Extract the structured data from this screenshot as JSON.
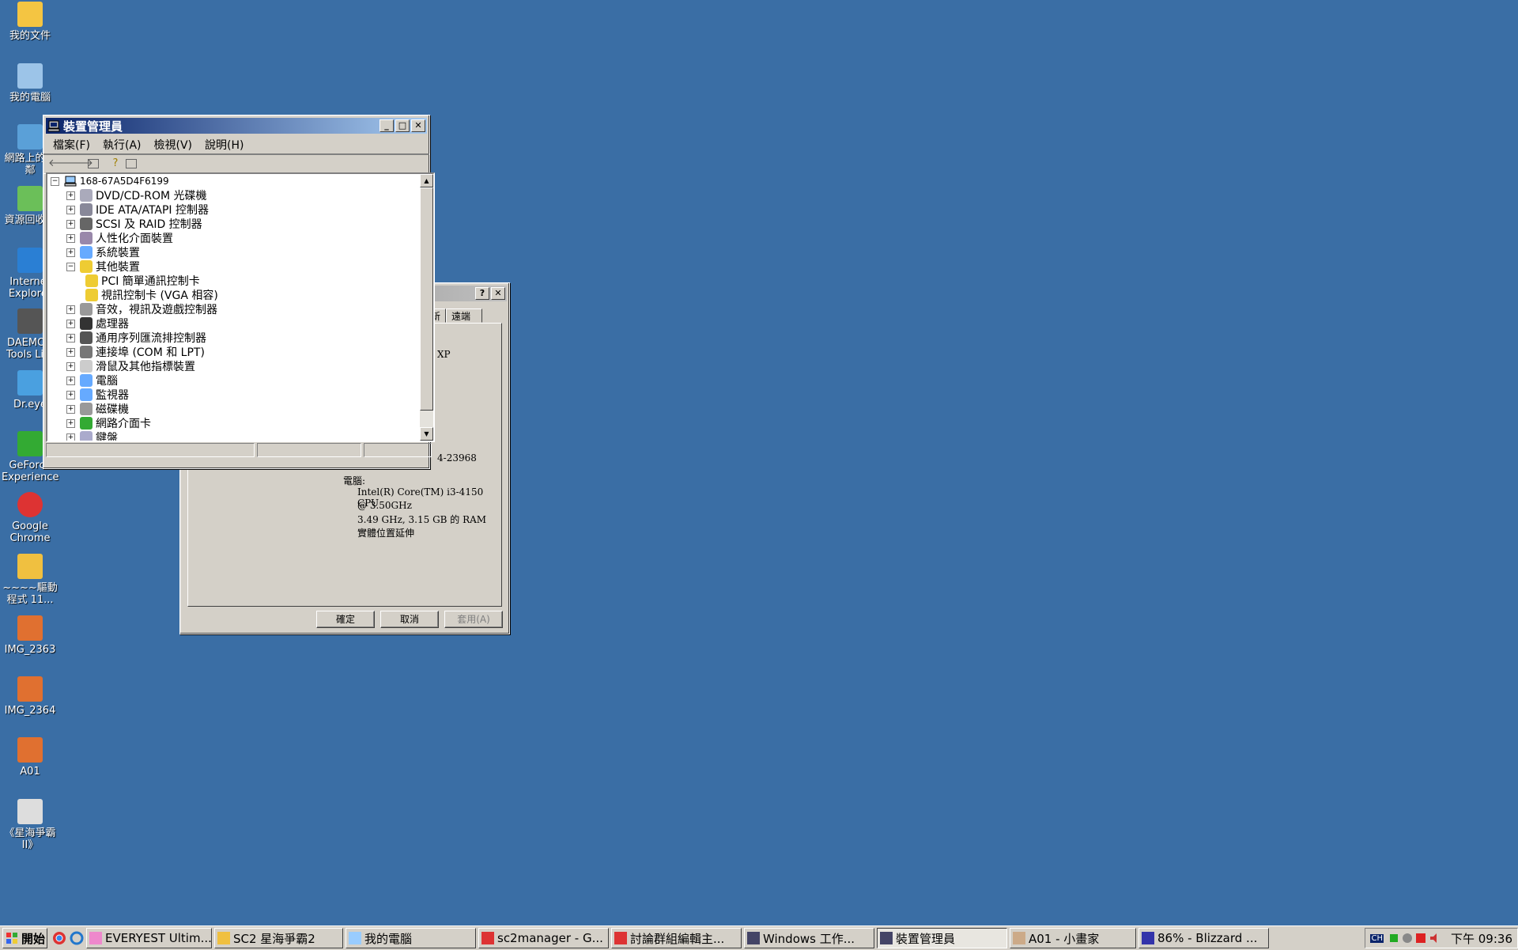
{
  "desktop": {
    "icons": [
      {
        "label": "我的文件"
      },
      {
        "label": "我的電腦"
      },
      {
        "label": "網路上的芳鄰"
      },
      {
        "label": "資源回收筒"
      },
      {
        "label": "Internet Explorer"
      },
      {
        "label": "DAEMON Tools Lite"
      },
      {
        "label": "Dr.eye"
      },
      {
        "label": "GeForce Experience"
      },
      {
        "label": "Google Chrome"
      },
      {
        "label": "~~~~驅動程式 11..."
      },
      {
        "label": "IMG_2363"
      },
      {
        "label": "IMG_2364"
      },
      {
        "label": "A01"
      },
      {
        "label": "《星海爭霸 II》"
      }
    ]
  },
  "device_manager": {
    "title": "裝置管理員",
    "menu": [
      "檔案(F)",
      "執行(A)",
      "檢視(V)",
      "說明(H)"
    ],
    "tree": {
      "root": "168-67A5D4F6199",
      "items": [
        {
          "label": "DVD/CD-ROM 光碟機",
          "state": "collapsed"
        },
        {
          "label": "IDE ATA/ATAPI 控制器",
          "state": "collapsed"
        },
        {
          "label": "SCSI 及 RAID 控制器",
          "state": "collapsed"
        },
        {
          "label": "人性化介面裝置",
          "state": "collapsed"
        },
        {
          "label": "系統裝置",
          "state": "collapsed"
        },
        {
          "label": "其他裝置",
          "state": "expanded"
        },
        {
          "label": "PCI 簡單通訊控制卡",
          "state": "child"
        },
        {
          "label": "視訊控制卡 (VGA 相容)",
          "state": "child"
        },
        {
          "label": "音效，視訊及遊戲控制器",
          "state": "collapsed"
        },
        {
          "label": "處理器",
          "state": "collapsed"
        },
        {
          "label": "通用序列匯流排控制器",
          "state": "collapsed"
        },
        {
          "label": "連接埠 (COM 和 LPT)",
          "state": "collapsed"
        },
        {
          "label": "滑鼠及其他指標裝置",
          "state": "collapsed"
        },
        {
          "label": "電腦",
          "state": "collapsed"
        },
        {
          "label": "監視器",
          "state": "collapsed"
        },
        {
          "label": "磁碟機",
          "state": "collapsed"
        },
        {
          "label": "網路介面卡",
          "state": "collapsed"
        },
        {
          "label": "鍵盤",
          "state": "collapsed"
        }
      ]
    }
  },
  "system_properties": {
    "tabs_visible": [
      "新",
      "遠端"
    ],
    "frag_xp": "XP",
    "frag_serial": "4-23968",
    "computer_label": "電腦:",
    "cpu_line1": "Intel(R) Core(TM) i3-4150 CPU",
    "cpu_line2": "@ 3.50GHz",
    "ram_line": "3.49 GHz, 3.15 GB 的 RAM",
    "pae_line": "實體位置延伸",
    "buttons": {
      "ok": "確定",
      "cancel": "取消",
      "apply": "套用(A)"
    }
  },
  "taskbar": {
    "start": "開始",
    "tasks": [
      {
        "label": "EVERYEST Ultim...",
        "pressed": false
      },
      {
        "label": "SC2 星海爭霸2",
        "pressed": false
      },
      {
        "label": "我的電腦",
        "pressed": false
      },
      {
        "label": "sc2manager - G...",
        "pressed": false
      },
      {
        "label": "討論群組編輯主...",
        "pressed": false
      },
      {
        "label": "Windows 工作...",
        "pressed": false
      },
      {
        "label": "裝置管理員",
        "pressed": true
      },
      {
        "label": "A01 - 小畫家",
        "pressed": false
      },
      {
        "label": "86% - Blizzard ...",
        "pressed": false
      }
    ],
    "lang": "CH",
    "clock": "下午 09:36"
  }
}
